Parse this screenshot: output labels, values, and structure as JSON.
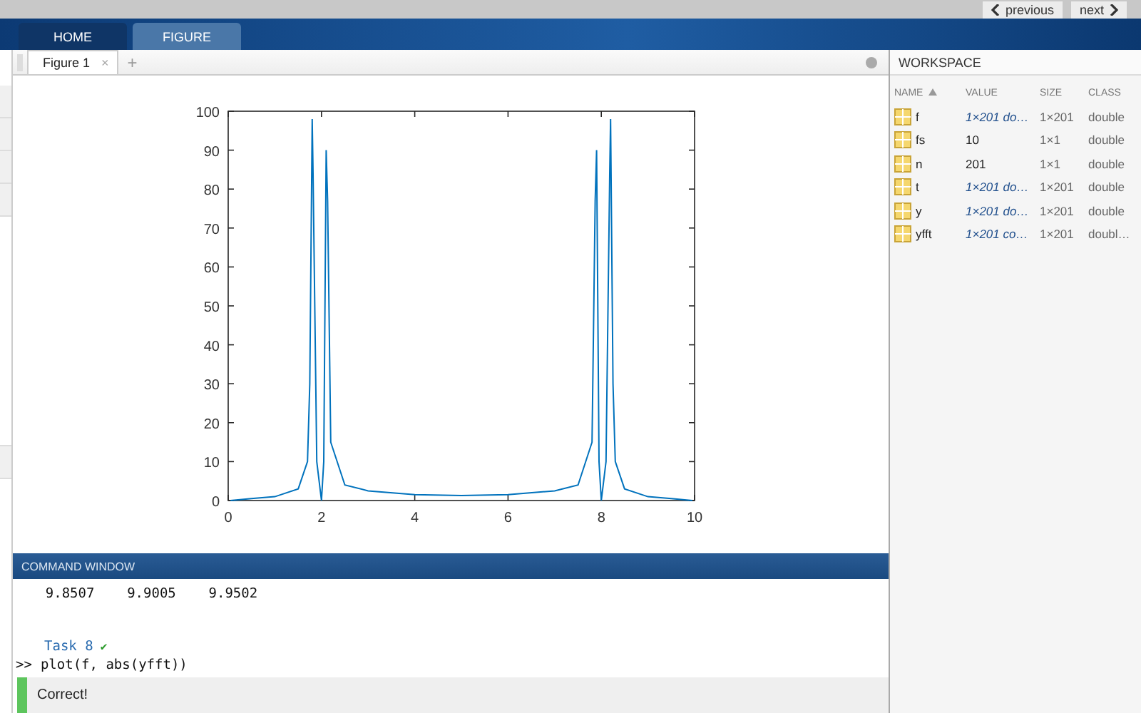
{
  "nav_buttons": [
    {
      "label": "previous",
      "kind": "prev"
    },
    {
      "label": "next",
      "kind": "next"
    }
  ],
  "ribbon_tabs": [
    {
      "label": "HOME",
      "selected": true
    },
    {
      "label": "FIGURE",
      "selected": false
    }
  ],
  "figure_tabs": [
    {
      "label": "Figure 1",
      "selected": true,
      "close": "×"
    }
  ],
  "add_tab": "+",
  "figure": {
    "chart_data": {
      "type": "line",
      "x": [
        0.05,
        0.5,
        1.0,
        1.5,
        1.7,
        1.75,
        1.8,
        1.82,
        1.9,
        2.0,
        2.05,
        2.1,
        2.13,
        2.2,
        2.5,
        3,
        4,
        5,
        6,
        7,
        7.5,
        7.8,
        7.87,
        7.9,
        7.95,
        8.0,
        8.1,
        8.18,
        8.2,
        8.25,
        8.3,
        8.5,
        9,
        9.5,
        9.95
      ],
      "series": [
        {
          "color": "#0072bd",
          "values": [
            0,
            0.5,
            1,
            3,
            10,
            30,
            98,
            84,
            10,
            0,
            10,
            90,
            77,
            15,
            4,
            2.5,
            1.5,
            1.3,
            1.5,
            2.5,
            4,
            15,
            77,
            90,
            10,
            0,
            10,
            84,
            98,
            30,
            10,
            3,
            1,
            0.5,
            0
          ]
        }
      ],
      "xlim": [
        0,
        10
      ],
      "ylim": [
        0,
        100
      ],
      "xticks": [
        0,
        2,
        4,
        6,
        8,
        10
      ],
      "yticks": [
        0,
        10,
        20,
        30,
        40,
        50,
        60,
        70,
        80,
        90,
        100
      ]
    }
  },
  "command_window": {
    "title": "COMMAND WINDOW",
    "lines": [
      {
        "kind": "output",
        "text": "    9.8507    9.9005    9.9502"
      },
      {
        "kind": "blank"
      },
      {
        "kind": "task",
        "text": "Task 8",
        "mark": "✔"
      },
      {
        "kind": "prompt",
        "prompt": ">>",
        "text": "plot(f, abs(yfft))"
      }
    ],
    "feedback": {
      "text": "Correct!",
      "kind": "correct"
    }
  },
  "workspace": {
    "title": "WORKSPACE",
    "columns": [
      {
        "label": "NAME",
        "sorted": true
      },
      {
        "label": "VALUE",
        "sorted": false
      },
      {
        "label": "SIZE",
        "sorted": false
      },
      {
        "label": "CLASS",
        "sorted": false
      }
    ],
    "rows": [
      {
        "name": "f",
        "value": "1×201 do…",
        "kind": "array",
        "size": "1×201",
        "class": "double"
      },
      {
        "name": "fs",
        "value": "10",
        "kind": "scalar",
        "size": "1×1",
        "class": "double"
      },
      {
        "name": "n",
        "value": "201",
        "kind": "scalar",
        "size": "1×1",
        "class": "double"
      },
      {
        "name": "t",
        "value": "1×201 do…",
        "kind": "array",
        "size": "1×201",
        "class": "double"
      },
      {
        "name": "y",
        "value": "1×201 do…",
        "kind": "array",
        "size": "1×201",
        "class": "double"
      },
      {
        "name": "yfft",
        "value": "1×201 co…",
        "kind": "array",
        "size": "1×201",
        "class": "doubl…"
      }
    ]
  }
}
